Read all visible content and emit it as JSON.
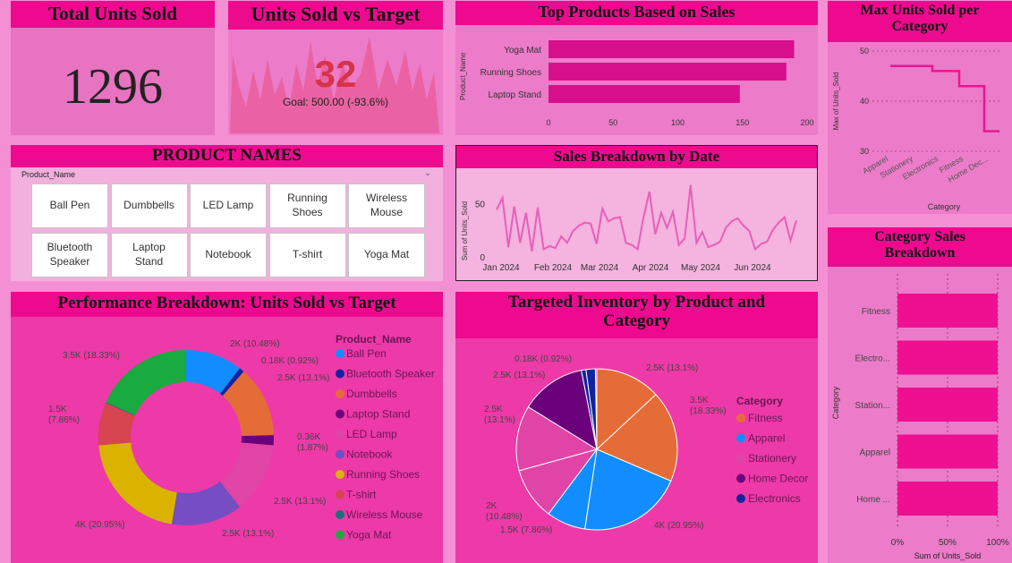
{
  "total_units": {
    "title": "Total Units Sold",
    "value": "1296"
  },
  "gauge": {
    "title": "Units Sold vs Target",
    "value": "32",
    "goal": "Goal: 500.00 (-93.6%)"
  },
  "top_products": {
    "title": "Top Products Based on Sales",
    "axis_label": "Product_Name",
    "categories": [
      "Yoga Mat",
      "Running Shoes",
      "Laptop Stand"
    ],
    "values": [
      190,
      184,
      148
    ],
    "ticks": [
      "0",
      "50",
      "100",
      "150",
      "200"
    ],
    "xlim": [
      0,
      200
    ]
  },
  "max_units": {
    "title": "Max Units Sold per Category",
    "ylabel": "Max of Units_Sold",
    "xlabel": "Category",
    "categories": [
      "Apparel",
      "Stationery",
      "Electronics",
      "Fitness",
      "Home Dec..."
    ],
    "values": [
      47,
      46,
      43,
      34
    ],
    "yticks": [
      "50",
      "40",
      "30"
    ],
    "ylim": [
      30,
      50
    ]
  },
  "product_names": {
    "title": "PRODUCT NAMES",
    "field": "Product_Name",
    "items": [
      "Ball Pen",
      "Dumbbells",
      "LED Lamp",
      "Running Shoes",
      "Wireless Mouse",
      "Bluetooth Speaker",
      "Laptop Stand",
      "Notebook",
      "T-shirt",
      "Yoga Mat"
    ]
  },
  "sales_breakdown": {
    "title": "Sales Breakdown by Date",
    "ylabel": "Sum of Units_Sold",
    "yticks": [
      "50",
      "0"
    ],
    "xticks": [
      "Jan 2024",
      "Feb 2024",
      "Mar 2024",
      "Apr 2024",
      "May 2024",
      "Jun 2024"
    ],
    "values": [
      45,
      56,
      10,
      48,
      14,
      42,
      6,
      47,
      8,
      11,
      9,
      20,
      14,
      25,
      30,
      33,
      32,
      13,
      46,
      34,
      37,
      38,
      14,
      12,
      8,
      38,
      62,
      22,
      42,
      28,
      43,
      12,
      18,
      68,
      14,
      24,
      10,
      12,
      15,
      28,
      34,
      37,
      30,
      25,
      8,
      13,
      15,
      26,
      33,
      38,
      16,
      35
    ],
    "ylim": [
      0,
      72
    ]
  },
  "performance": {
    "title": "Performance Breakdown: Units Sold vs Target",
    "legend_title": "Product_Name",
    "items": [
      "Ball Pen",
      "Bluetooth Speaker",
      "Dumbbells",
      "Laptop Stand",
      "LED Lamp",
      "Notebook",
      "Running Shoes",
      "T-shirt",
      "Wireless Mouse",
      "Yoga Mat"
    ],
    "colors": [
      "#118dff",
      "#12239e",
      "#e66c37",
      "#6b007b",
      "#e044a7",
      "#744ec2",
      "#d9b300",
      "#d64550",
      "#197278",
      "#1aab40"
    ],
    "values": [
      10.48,
      0.92,
      13.1,
      1.87,
      13.1,
      13.1,
      20.95,
      7.86,
      0.18,
      18.33
    ],
    "labels": [
      "2K (10.48%)",
      "0.18K (0.92%)",
      "2.5K (13.1%)",
      "0.36K\n(1.87%)",
      "2.5K (13.1%)",
      "2.5K (13.1%)",
      "4K (20.95%)",
      "1.5K\n(7.86%)",
      "",
      "3.5K (18.33%)"
    ]
  },
  "inventory": {
    "title": "Targeted Inventory by Product and Category",
    "legend_title": "Category",
    "legend": [
      "Fitness",
      "Apparel",
      "Stationery",
      "Home Decor",
      "Electronics"
    ],
    "legend_colors": [
      "#e66c37",
      "#118dff",
      "#e044a7",
      "#6b007b",
      "#12239e"
    ],
    "slices": [
      {
        "value": 13.1,
        "color": "#e66c37",
        "label": "2.5K (13.1%)"
      },
      {
        "value": 18.33,
        "color": "#e66c37",
        "label": "3.5K\n(18.33%)"
      },
      {
        "value": 20.95,
        "color": "#118dff",
        "label": "4K (20.95%)"
      },
      {
        "value": 7.86,
        "color": "#118dff",
        "label": "1.5K (7.86%)"
      },
      {
        "value": 10.48,
        "color": "#e044a7",
        "label": "2K\n(10.48%)"
      },
      {
        "value": 13.1,
        "color": "#e044a7",
        "label": "2.5K\n(13.1%)"
      },
      {
        "value": 13.1,
        "color": "#6b007b",
        "label": "2.5K (13.1%)"
      },
      {
        "value": 0.92,
        "color": "#12239e",
        "label": "0.18K (0.92%)"
      },
      {
        "value": 1.87,
        "color": "#12239e",
        "label": ""
      }
    ]
  },
  "category_sales": {
    "title": "Category Sales Breakdown",
    "ylabel": "Category",
    "xlabel": "Sum of Units_Sold",
    "categories": [
      "Fitness",
      "Electro...",
      "Station...",
      "Apparel",
      "Home ..."
    ],
    "values": [
      100,
      100,
      100,
      100,
      100
    ],
    "xticks": [
      "0%",
      "50%",
      "100%"
    ]
  },
  "colors": {
    "title_bg": "#ed0a8e",
    "card_bg": "#ec7cc9",
    "bar": "#d80f8c",
    "line": "#e75fb8"
  }
}
